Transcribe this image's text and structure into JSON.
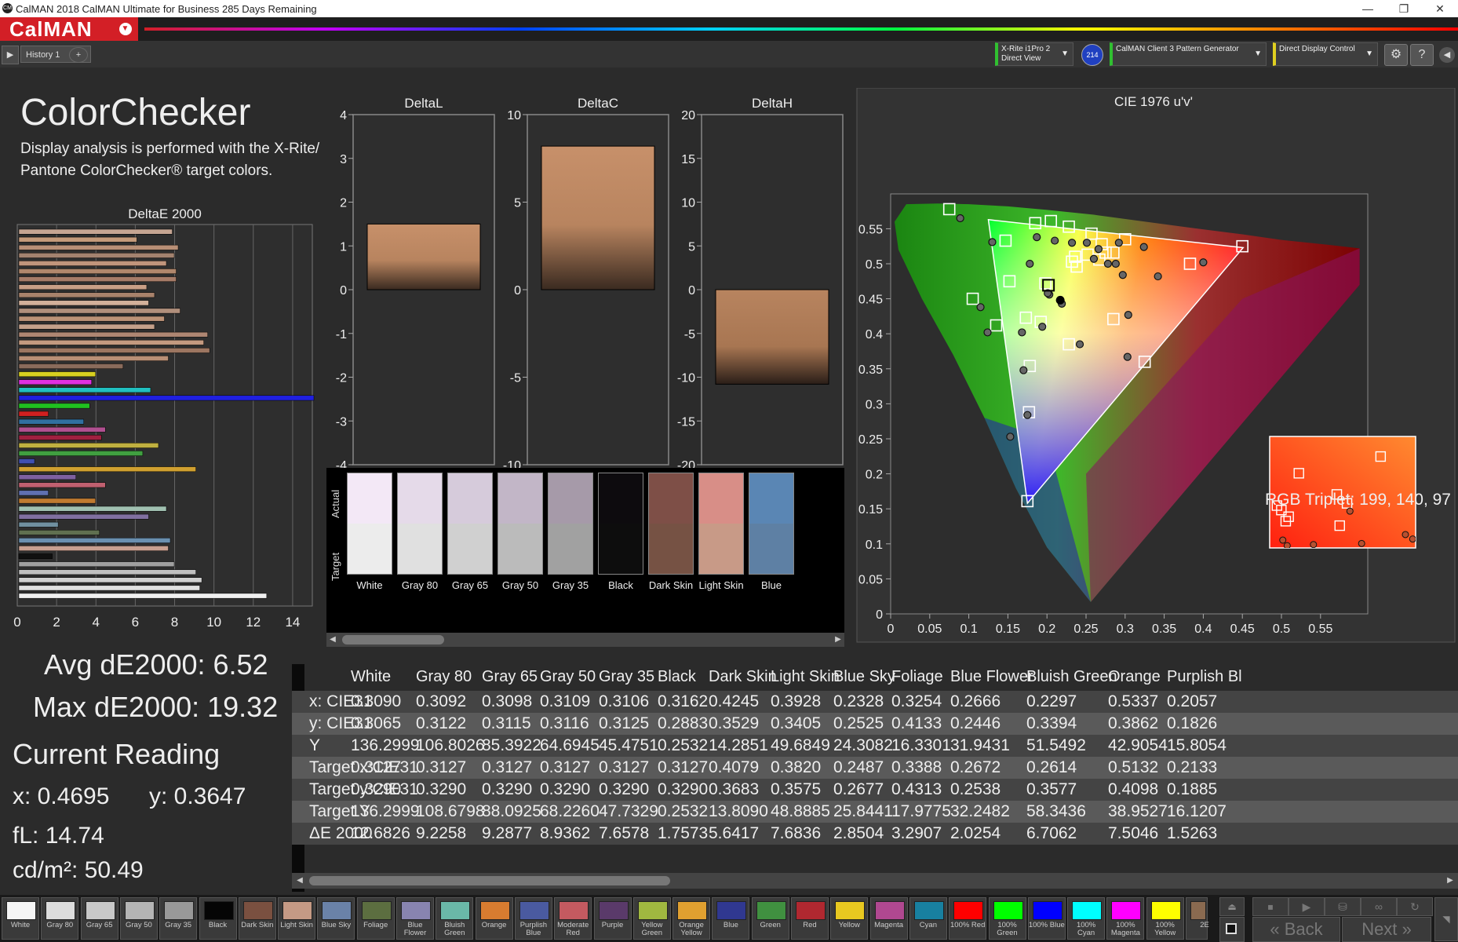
{
  "window": {
    "title": "CalMAN 2018 CalMAN Ultimate for Business 285 Days Remaining"
  },
  "app": {
    "logo": "CalMAN",
    "history_tab": "History 1"
  },
  "devices": {
    "meter": "X-Rite i1Pro 2\nDirect View",
    "meter_badge": "214",
    "pattern": "CalMAN Client 3 Pattern Generator",
    "display": "Direct Display Control"
  },
  "header": {
    "title": "ColorChecker",
    "description": "Display analysis is performed with the X-Rite/\nPantone ColorChecker® target colors."
  },
  "deltae_chart": {
    "title": "DeltaE 2000",
    "x_ticks": [
      "0",
      "2",
      "4",
      "6",
      "8",
      "10",
      "12",
      "14"
    ],
    "bars": [
      {
        "value": 7.8,
        "color": "#c5a592"
      },
      {
        "value": 6.0,
        "color": "#c49a7a"
      },
      {
        "value": 8.1,
        "color": "#b88f76"
      },
      {
        "value": 7.9,
        "color": "#a3826f"
      },
      {
        "value": 7.5,
        "color": "#c1957c"
      },
      {
        "value": 8.0,
        "color": "#b0876c"
      },
      {
        "value": 8.0,
        "color": "#a67c68"
      },
      {
        "value": 6.5,
        "color": "#c99f86"
      },
      {
        "value": 6.9,
        "color": "#a8826b"
      },
      {
        "value": 6.6,
        "color": "#d2b09a"
      },
      {
        "value": 8.2,
        "color": "#b08f7c"
      },
      {
        "value": 7.4,
        "color": "#bb9277"
      },
      {
        "value": 6.9,
        "color": "#c4a08a"
      },
      {
        "value": 9.6,
        "color": "#ae8672"
      },
      {
        "value": 9.4,
        "color": "#c49a80"
      },
      {
        "value": 9.7,
        "color": "#9c7661"
      },
      {
        "value": 7.6,
        "color": "#b98f76"
      },
      {
        "value": 5.3,
        "color": "#8a6b5b"
      },
      {
        "value": 3.9,
        "color": "#d8d020"
      },
      {
        "value": 3.7,
        "color": "#e030e0"
      },
      {
        "value": 6.7,
        "color": "#20c0c0"
      },
      {
        "value": 15.0,
        "color": "#2020e0"
      },
      {
        "value": 3.6,
        "color": "#20c020"
      },
      {
        "value": 1.5,
        "color": "#d02020"
      },
      {
        "value": 3.3,
        "color": "#3070a0"
      },
      {
        "value": 4.4,
        "color": "#b05090"
      },
      {
        "value": 4.2,
        "color": "#a02040"
      },
      {
        "value": 7.1,
        "color": "#c0b040"
      },
      {
        "value": 6.3,
        "color": "#40a040"
      },
      {
        "value": 0.8,
        "color": "#4050b0"
      },
      {
        "value": 9.0,
        "color": "#d0a030"
      },
      {
        "value": 2.9,
        "color": "#7e60a0"
      },
      {
        "value": 4.4,
        "color": "#c06070"
      },
      {
        "value": 1.5,
        "color": "#6070b0"
      },
      {
        "value": 3.9,
        "color": "#c07a30"
      },
      {
        "value": 7.5,
        "color": "#a0c0b0"
      },
      {
        "value": 6.6,
        "color": "#8070a0"
      },
      {
        "value": 2.0,
        "color": "#7090a0"
      },
      {
        "value": 4.1,
        "color": "#607050"
      },
      {
        "value": 7.7,
        "color": "#6a90b0"
      },
      {
        "value": 7.6,
        "color": "#c8a090"
      },
      {
        "value": 1.7,
        "color": "#101010"
      },
      {
        "value": 7.9,
        "color": "#a0a0a0"
      },
      {
        "value": 9.0,
        "color": "#c0c0c0"
      },
      {
        "value": 9.3,
        "color": "#d0d0d0"
      },
      {
        "value": 9.2,
        "color": "#e0e0e0"
      },
      {
        "value": 12.6,
        "color": "#f0f0f0"
      }
    ]
  },
  "delta_charts": [
    {
      "title": "DeltaL",
      "ticks": [
        "4",
        "3",
        "2",
        "1",
        "0",
        "-1",
        "-2",
        "-3",
        "-4"
      ],
      "min": -4,
      "max": 4,
      "value": 1.5
    },
    {
      "title": "DeltaC",
      "ticks": [
        "10",
        "5",
        "0",
        "-5",
        "-10"
      ],
      "min": -10,
      "max": 10,
      "value": 8.2
    },
    {
      "title": "DeltaH",
      "ticks": [
        "20",
        "15",
        "10",
        "5",
        "0",
        "-5",
        "-10",
        "-15",
        "-20"
      ],
      "min": -20,
      "max": 20,
      "value": -10.8
    }
  ],
  "swatch_panel": {
    "actual_label": "Actual",
    "target_label": "Target",
    "swatches": [
      {
        "name": "White",
        "actual": "#f3e8f6",
        "target": "#ececec"
      },
      {
        "name": "Gray 80",
        "actual": "#e5dae9",
        "target": "#e0e0e0"
      },
      {
        "name": "Gray 65",
        "actual": "#d6cbdb",
        "target": "#d0d0d0"
      },
      {
        "name": "Gray 50",
        "actual": "#c2b6c7",
        "target": "#bbbbbb"
      },
      {
        "name": "Gray 35",
        "actual": "#a69aa9",
        "target": "#a1a1a1"
      },
      {
        "name": "Black",
        "actual": "#0d0b0e",
        "target": "#0d0d0d"
      },
      {
        "name": "Dark Skin",
        "actual": "#7e4f47",
        "target": "#765244"
      },
      {
        "name": "Light Skin",
        "actual": "#d88e87",
        "target": "#c89a87"
      },
      {
        "name": "Blue",
        "actual": "#5a86b4",
        "target": "#5e80a4"
      }
    ]
  },
  "cie_chart": {
    "title": "CIE 1976 u'v'",
    "x_ticks": [
      "0",
      "0.05",
      "0.1",
      "0.15",
      "0.2",
      "0.25",
      "0.3",
      "0.35",
      "0.4",
      "0.45",
      "0.5",
      "0.55"
    ],
    "y_ticks": [
      "0",
      "0.05",
      "0.1",
      "0.15",
      "0.2",
      "0.25",
      "0.3",
      "0.35",
      "0.4",
      "0.45",
      "0.5",
      "0.55"
    ],
    "gamut": {
      "red": [
        0.451,
        0.523
      ],
      "green": [
        0.125,
        0.563
      ],
      "blue": [
        0.175,
        0.158
      ]
    },
    "targets": [
      [
        0.075,
        0.578
      ],
      [
        0.147,
        0.533
      ],
      [
        0.185,
        0.558
      ],
      [
        0.205,
        0.561
      ],
      [
        0.228,
        0.553
      ],
      [
        0.257,
        0.543
      ],
      [
        0.27,
        0.528
      ],
      [
        0.3,
        0.535
      ],
      [
        0.285,
        0.516
      ],
      [
        0.275,
        0.516
      ],
      [
        0.252,
        0.513
      ],
      [
        0.236,
        0.51
      ],
      [
        0.232,
        0.503
      ],
      [
        0.267,
        0.506
      ],
      [
        0.238,
        0.496
      ],
      [
        0.383,
        0.5
      ],
      [
        0.45,
        0.525
      ],
      [
        0.198,
        0.472
      ],
      [
        0.152,
        0.475
      ],
      [
        0.105,
        0.45
      ],
      [
        0.135,
        0.412
      ],
      [
        0.173,
        0.423
      ],
      [
        0.192,
        0.417
      ],
      [
        0.285,
        0.421
      ],
      [
        0.228,
        0.385
      ],
      [
        0.325,
        0.36
      ],
      [
        0.178,
        0.354
      ],
      [
        0.177,
        0.288
      ],
      [
        0.175,
        0.161
      ]
    ],
    "actuals": [
      [
        0.089,
        0.565
      ],
      [
        0.13,
        0.531
      ],
      [
        0.187,
        0.538
      ],
      [
        0.178,
        0.5
      ],
      [
        0.21,
        0.533
      ],
      [
        0.232,
        0.53
      ],
      [
        0.251,
        0.53
      ],
      [
        0.266,
        0.521
      ],
      [
        0.292,
        0.53
      ],
      [
        0.324,
        0.524
      ],
      [
        0.288,
        0.5
      ],
      [
        0.278,
        0.5
      ],
      [
        0.26,
        0.507
      ],
      [
        0.203,
        0.456
      ],
      [
        0.219,
        0.443
      ],
      [
        0.4,
        0.502
      ],
      [
        0.342,
        0.482
      ],
      [
        0.297,
        0.484
      ],
      [
        0.115,
        0.438
      ],
      [
        0.124,
        0.402
      ],
      [
        0.168,
        0.402
      ],
      [
        0.194,
        0.41
      ],
      [
        0.304,
        0.427
      ],
      [
        0.242,
        0.385
      ],
      [
        0.303,
        0.367
      ],
      [
        0.17,
        0.348
      ],
      [
        0.175,
        0.284
      ],
      [
        0.153,
        0.253
      ],
      [
        0.201,
        0.458
      ]
    ],
    "current": [
      0.217,
      0.448
    ],
    "inset_label": "RGB Triplet: 199, 140, 97"
  },
  "summary": {
    "avg": "Avg dE2000: 6.52",
    "max": "Max dE2000: 19.32",
    "current_title": "Current Reading",
    "x": "x: 0.4695",
    "y": "y: 0.3647",
    "fl": "fL: 14.74",
    "cdm": "cd/m²: 50.49"
  },
  "table": {
    "columns": [
      "White",
      "Gray 80",
      "Gray 65",
      "Gray 50",
      "Gray 35",
      "Black",
      "Dark Skin",
      "Light Skin",
      "Blue Sky",
      "Foliage",
      "Blue Flower",
      "Bluish Green",
      "Orange",
      "Purplish Bl"
    ],
    "rows": [
      {
        "label": "x: CIE31",
        "values": [
          "0.3090",
          "0.3092",
          "0.3098",
          "0.3109",
          "0.3106",
          "0.3162",
          "0.4245",
          "0.3928",
          "0.2328",
          "0.3254",
          "0.2666",
          "0.2297",
          "0.5337",
          "0.2057"
        ]
      },
      {
        "label": "y: CIE31",
        "values": [
          "0.3065",
          "0.3122",
          "0.3115",
          "0.3116",
          "0.3125",
          "0.2883",
          "0.3529",
          "0.3405",
          "0.2525",
          "0.4133",
          "0.2446",
          "0.3394",
          "0.3862",
          "0.1826"
        ]
      },
      {
        "label": "Y",
        "values": [
          "136.2999",
          "106.8026",
          "85.3922",
          "64.6945",
          "45.4751",
          "0.2532",
          "14.2851",
          "49.6849",
          "24.3082",
          "16.3301",
          "31.9431",
          "51.5492",
          "42.9054",
          "15.8054"
        ]
      },
      {
        "label": "Target x:CIE31",
        "values": [
          "0.3127",
          "0.3127",
          "0.3127",
          "0.3127",
          "0.3127",
          "0.3127",
          "0.4079",
          "0.3820",
          "0.2487",
          "0.3388",
          "0.2672",
          "0.2614",
          "0.5132",
          "0.2133"
        ]
      },
      {
        "label": "Target y:CIE31",
        "values": [
          "0.3290",
          "0.3290",
          "0.3290",
          "0.3290",
          "0.3290",
          "0.3290",
          "0.3683",
          "0.3575",
          "0.2677",
          "0.4313",
          "0.2538",
          "0.3577",
          "0.4098",
          "0.1885"
        ]
      },
      {
        "label": "Target Y",
        "values": [
          "136.2999",
          "108.6798",
          "88.0925",
          "68.2260",
          "47.7329",
          "0.2532",
          "13.8090",
          "48.8885",
          "25.8441",
          "17.9775",
          "32.2482",
          "58.3436",
          "38.9527",
          "16.1207"
        ]
      },
      {
        "label": "ΔE 2000",
        "values": [
          "12.6826",
          "9.2258",
          "9.2877",
          "8.9362",
          "7.6578",
          "1.7573",
          "5.6417",
          "7.6836",
          "2.8504",
          "3.2907",
          "2.0254",
          "6.7062",
          "7.5046",
          "1.5263"
        ]
      }
    ]
  },
  "bottom_swatches": [
    {
      "name": "White",
      "color": "#f5f5f5"
    },
    {
      "name": "Gray 80",
      "color": "#dcdcdc"
    },
    {
      "name": "Gray 65",
      "color": "#c8c8c8"
    },
    {
      "name": "Gray 50",
      "color": "#b4b4b4"
    },
    {
      "name": "Gray 35",
      "color": "#999999"
    },
    {
      "name": "Black",
      "color": "#050505"
    },
    {
      "name": "Dark Skin",
      "color": "#7a5040"
    },
    {
      "name": "Light Skin",
      "color": "#c59a85"
    },
    {
      "name": "Blue Sky",
      "color": "#6a82a8"
    },
    {
      "name": "Foliage",
      "color": "#5c6e40"
    },
    {
      "name": "Blue Flower",
      "color": "#8884b0"
    },
    {
      "name": "Bluish Green",
      "color": "#6ab8a8"
    },
    {
      "name": "Orange",
      "color": "#d87c30"
    },
    {
      "name": "Purplish Blue",
      "color": "#4a5aa0"
    },
    {
      "name": "Moderate Red",
      "color": "#c45a60"
    },
    {
      "name": "Purple",
      "color": "#5a3a6a"
    },
    {
      "name": "Yellow Green",
      "color": "#a0b840"
    },
    {
      "name": "Orange Yellow",
      "color": "#e0a030"
    },
    {
      "name": "Blue",
      "color": "#303890"
    },
    {
      "name": "Green",
      "color": "#409040"
    },
    {
      "name": "Red",
      "color": "#b02830"
    },
    {
      "name": "Yellow",
      "color": "#e8c820"
    },
    {
      "name": "Magenta",
      "color": "#b04890"
    },
    {
      "name": "Cyan",
      "color": "#1880a0"
    },
    {
      "name": "100% Red",
      "color": "#ff0000"
    },
    {
      "name": "100% Green",
      "color": "#00ff00"
    },
    {
      "name": "100% Blue",
      "color": "#0000ff"
    },
    {
      "name": "100% Cyan",
      "color": "#00ffff"
    },
    {
      "name": "100% Magenta",
      "color": "#ff00ff"
    },
    {
      "name": "100% Yellow",
      "color": "#ffff00"
    },
    {
      "name": "2E",
      "color": "#8a6a50"
    }
  ],
  "navigation": {
    "back": "Back",
    "next": "Next"
  }
}
